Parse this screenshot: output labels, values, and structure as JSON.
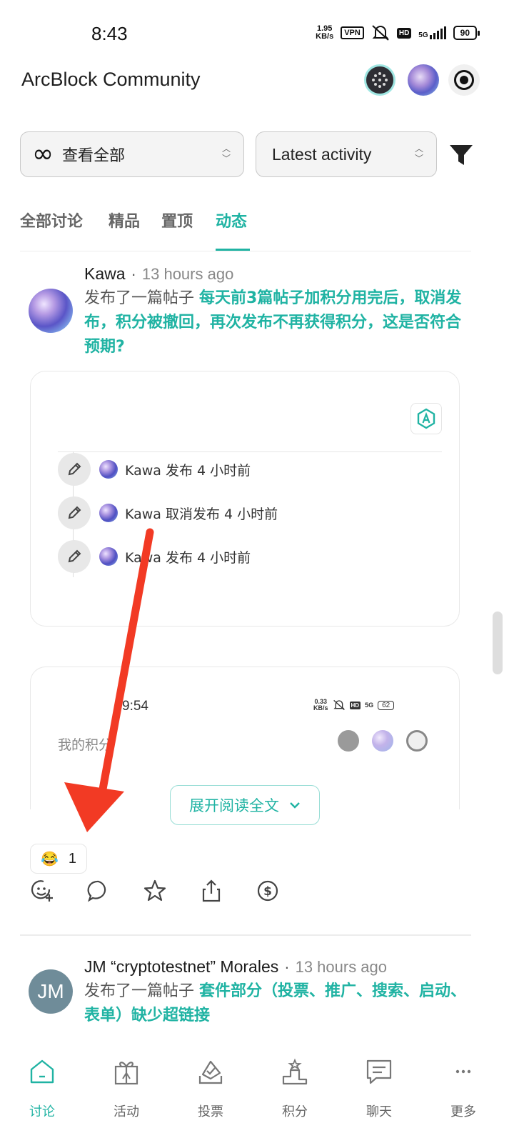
{
  "status_bar": {
    "time": "8:43",
    "net_speed_value": "1.95",
    "net_speed_unit": "KB/s",
    "vpn": "VPN",
    "hd": "HD",
    "network": "5G",
    "battery": "90"
  },
  "header": {
    "title": "ArcBlock Community"
  },
  "filters": {
    "scope_label": "查看全部",
    "sort_label": "Latest activity"
  },
  "tabs": [
    {
      "label": "全部讨论",
      "active": false
    },
    {
      "label": "精品",
      "active": false
    },
    {
      "label": "置顶",
      "active": false
    },
    {
      "label": "动态",
      "active": true
    }
  ],
  "posts": [
    {
      "author": "Kawa",
      "separator": "·",
      "time": "13 hours ago",
      "action": "发布了一篇帖子",
      "title": "每天前3篇帖子加积分用完后，取消发布，积分被撤回，再次发布不再获得积分，这是否符合预期?",
      "history": [
        {
          "user": "Kawa",
          "text": "发布 4 小时前"
        },
        {
          "user": "Kawa",
          "text": "取消发布 4 小时前"
        },
        {
          "user": "Kawa",
          "text": "发布 4 小时前"
        }
      ],
      "embedded_screenshot": {
        "time": "9:54",
        "net_speed_value": "0.33",
        "net_speed_unit": "KB/s",
        "hd": "HD",
        "network": "5G",
        "battery": "62",
        "title": "我的积分"
      },
      "expand_label": "展开阅读全文",
      "reaction": {
        "emoji": "😂",
        "count": "1"
      }
    },
    {
      "author": "JM “cryptotestnet” Morales",
      "separator": "·",
      "time": "13 hours ago",
      "avatar_initials": "JM",
      "action": "发布了一篇帖子",
      "title": "套件部分（投票、推广、搜索、启动、表单）缺少超链接"
    }
  ],
  "bottom_nav": [
    {
      "label": "讨论",
      "icon": "home-icon",
      "active": true
    },
    {
      "label": "活动",
      "icon": "gift-icon",
      "active": false
    },
    {
      "label": "投票",
      "icon": "vote-icon",
      "active": false
    },
    {
      "label": "积分",
      "icon": "podium-icon",
      "active": false
    },
    {
      "label": "聊天",
      "icon": "chat-icon",
      "active": false
    },
    {
      "label": "更多",
      "icon": "more-icon",
      "active": false
    }
  ],
  "colors": {
    "accent": "#20b3a3",
    "annotation_arrow": "#f23a24"
  }
}
